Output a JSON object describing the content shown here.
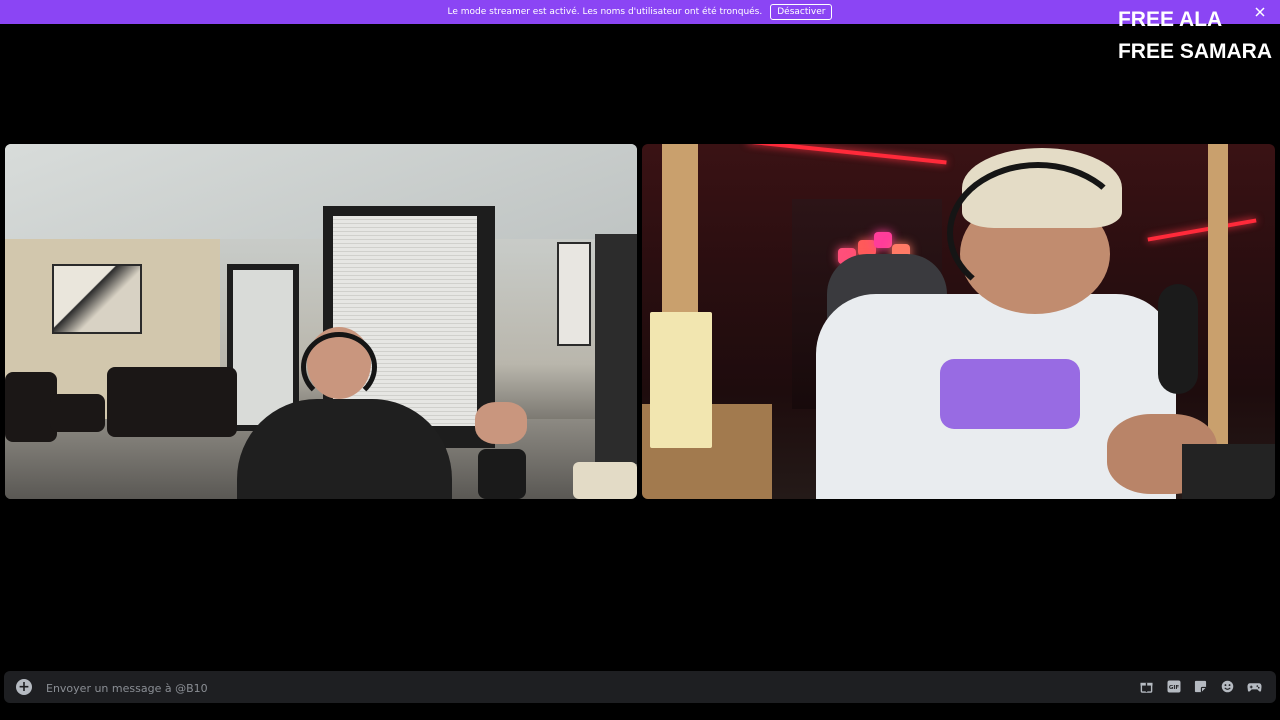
{
  "banner": {
    "message": "Le mode streamer est activé. Les noms d'utilisateur ont été tronqués.",
    "disable_label": "Désactiver",
    "close_icon": "close-icon",
    "color": "#8b45f4"
  },
  "overlay": {
    "line1": "FREE ALA",
    "line2": "FREE SAMARA"
  },
  "video_tiles": [
    {
      "id": "left-stream"
    },
    {
      "id": "right-stream"
    }
  ],
  "composer": {
    "placeholder": "Envoyer un message à @B10",
    "add_icon": "plus-circle-icon",
    "icons": [
      "gift-icon",
      "gif-icon",
      "sticker-icon",
      "emoji-icon",
      "game-controller-icon"
    ]
  }
}
